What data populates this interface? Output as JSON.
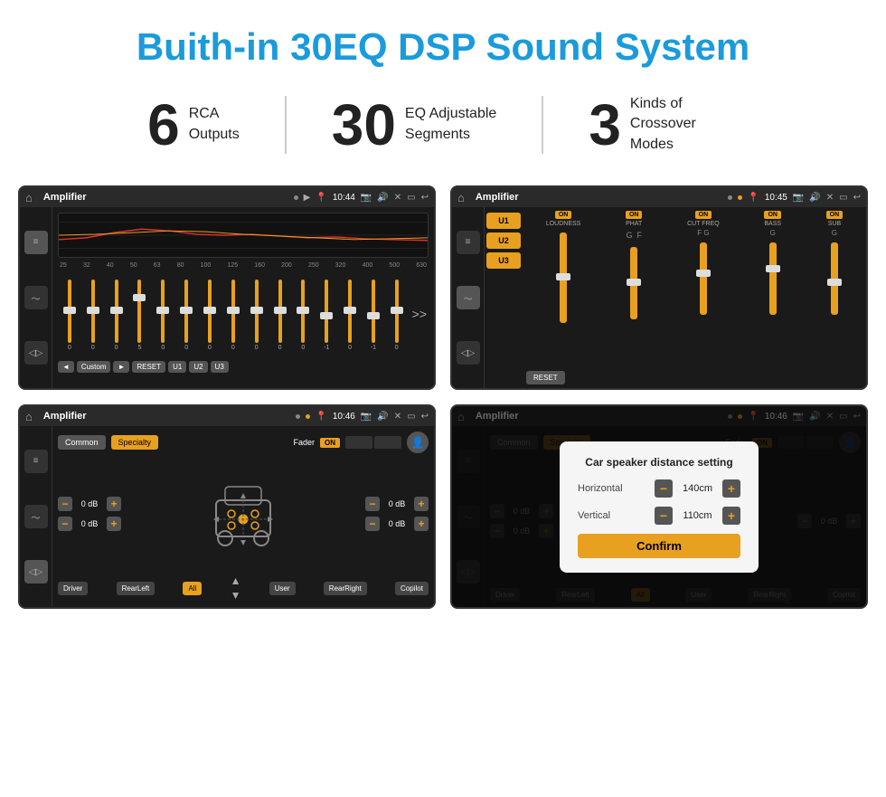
{
  "page": {
    "title": "Buith-in 30EQ DSP Sound System",
    "stats": [
      {
        "number": "6",
        "label": "RCA\nOutputs"
      },
      {
        "number": "30",
        "label": "EQ Adjustable\nSegments"
      },
      {
        "number": "3",
        "label": "Kinds of\nCrossover Modes"
      }
    ]
  },
  "screens": {
    "eq_screen": {
      "topbar": {
        "title": "Amplifier",
        "time": "10:44"
      },
      "freq_labels": [
        "25",
        "32",
        "40",
        "50",
        "63",
        "80",
        "100",
        "125",
        "160",
        "200",
        "250",
        "320",
        "400",
        "500",
        "630"
      ],
      "eq_values": [
        "0",
        "0",
        "0",
        "5",
        "0",
        "0",
        "0",
        "0",
        "0",
        "0",
        "0",
        "-1",
        "0",
        "-1"
      ],
      "controls": [
        "◄",
        "Custom",
        "►",
        "RESET",
        "U1",
        "U2",
        "U3"
      ]
    },
    "crossover_screen": {
      "topbar": {
        "title": "Amplifier",
        "time": "10:45"
      },
      "u_buttons": [
        "U1",
        "U2",
        "U3"
      ],
      "channels": [
        {
          "name": "LOUDNESS",
          "on": true
        },
        {
          "name": "PHAT",
          "on": true
        },
        {
          "name": "CUT FREQ",
          "on": true
        },
        {
          "name": "BASS",
          "on": true
        },
        {
          "name": "SUB",
          "on": true
        }
      ],
      "reset_label": "RESET"
    },
    "fader_screen": {
      "topbar": {
        "title": "Amplifier",
        "time": "10:46"
      },
      "tabs": [
        "Common",
        "Specialty"
      ],
      "fader_label": "Fader",
      "on_label": "ON",
      "positions": [
        "Driver",
        "RearLeft",
        "All",
        "User",
        "RearRight",
        "Copilot"
      ],
      "db_rows": [
        {
          "label": "left_top",
          "value": "0 dB"
        },
        {
          "label": "right_top",
          "value": "0 dB"
        },
        {
          "label": "left_bottom",
          "value": "0 dB"
        },
        {
          "label": "right_bottom",
          "value": "0 dB"
        }
      ]
    },
    "dialog_screen": {
      "topbar": {
        "title": "Amplifier",
        "time": "10:46"
      },
      "tabs": [
        "Common",
        "Specialty"
      ],
      "dialog": {
        "title": "Car speaker distance setting",
        "horizontal_label": "Horizontal",
        "horizontal_value": "140cm",
        "vertical_label": "Vertical",
        "vertical_value": "110cm",
        "confirm_label": "Confirm"
      },
      "positions": [
        "Driver",
        "RearLeft",
        "All",
        "User",
        "RearRight",
        "Copilot"
      ],
      "db_rows": [
        {
          "value": "0 dB"
        },
        {
          "value": "0 dB"
        }
      ]
    }
  },
  "ui": {
    "minus_symbol": "−",
    "plus_symbol": "+",
    "home_symbol": "⌂",
    "back_symbol": "↩",
    "volume_symbol": "♪",
    "pin_symbol": "📍"
  }
}
